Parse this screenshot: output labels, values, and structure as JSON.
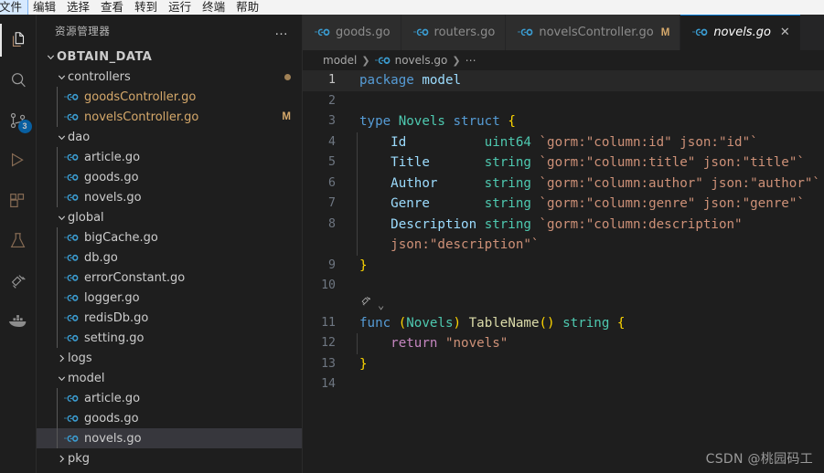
{
  "menubar": {
    "items": [
      {
        "label": "文件",
        "active": true
      },
      {
        "label": "编辑",
        "active": false
      },
      {
        "label": "选择",
        "active": false
      },
      {
        "label": "查看",
        "active": false
      },
      {
        "label": "转到",
        "active": false
      },
      {
        "label": "运行",
        "active": false
      },
      {
        "label": "终端",
        "active": false
      },
      {
        "label": "帮助",
        "active": false
      }
    ]
  },
  "activitybar": {
    "items": [
      {
        "name": "explorer",
        "icon": "files-icon",
        "selected": true,
        "badge": ""
      },
      {
        "name": "search",
        "icon": "search-icon",
        "selected": false,
        "badge": ""
      },
      {
        "name": "source-control",
        "icon": "source-control-icon",
        "selected": false,
        "badge": "3"
      },
      {
        "name": "run-debug",
        "icon": "run-and-debug-icon",
        "selected": false,
        "badge": ""
      },
      {
        "name": "extensions",
        "icon": "extensions-icon",
        "selected": false,
        "badge": ""
      },
      {
        "name": "testing",
        "icon": "beaker-icon",
        "selected": false,
        "badge": ""
      },
      {
        "name": "go",
        "icon": "go-gopher-icon",
        "selected": false,
        "badge": ""
      },
      {
        "name": "docker",
        "icon": "docker-whale-icon",
        "selected": false,
        "badge": ""
      }
    ]
  },
  "sidebar": {
    "title": "资源管理器",
    "more_actions": "…",
    "root": "OBTAIN_DATA",
    "tree": [
      {
        "label": "controllers",
        "type": "folder",
        "expanded": true,
        "depth": 1,
        "status": "dot"
      },
      {
        "label": "goodsController.go",
        "type": "go",
        "depth": 2,
        "modified": true,
        "status": ""
      },
      {
        "label": "novelsController.go",
        "type": "go",
        "depth": 2,
        "modified": true,
        "status": "M"
      },
      {
        "label": "dao",
        "type": "folder",
        "expanded": true,
        "depth": 1,
        "status": ""
      },
      {
        "label": "article.go",
        "type": "go",
        "depth": 2,
        "modified": false,
        "status": ""
      },
      {
        "label": "goods.go",
        "type": "go",
        "depth": 2,
        "modified": false,
        "status": ""
      },
      {
        "label": "novels.go",
        "type": "go",
        "depth": 2,
        "modified": false,
        "status": ""
      },
      {
        "label": "global",
        "type": "folder",
        "expanded": true,
        "depth": 1,
        "status": ""
      },
      {
        "label": "bigCache.go",
        "type": "go",
        "depth": 2,
        "modified": false,
        "status": ""
      },
      {
        "label": "db.go",
        "type": "go",
        "depth": 2,
        "modified": false,
        "status": ""
      },
      {
        "label": "errorConstant.go",
        "type": "go",
        "depth": 2,
        "modified": false,
        "status": ""
      },
      {
        "label": "logger.go",
        "type": "go",
        "depth": 2,
        "modified": false,
        "status": ""
      },
      {
        "label": "redisDb.go",
        "type": "go",
        "depth": 2,
        "modified": false,
        "status": ""
      },
      {
        "label": "setting.go",
        "type": "go",
        "depth": 2,
        "modified": false,
        "status": ""
      },
      {
        "label": "logs",
        "type": "folder",
        "expanded": false,
        "depth": 1,
        "status": ""
      },
      {
        "label": "model",
        "type": "folder",
        "expanded": true,
        "depth": 1,
        "status": ""
      },
      {
        "label": "article.go",
        "type": "go",
        "depth": 2,
        "modified": false,
        "status": ""
      },
      {
        "label": "goods.go",
        "type": "go",
        "depth": 2,
        "modified": false,
        "status": ""
      },
      {
        "label": "novels.go",
        "type": "go",
        "depth": 2,
        "modified": false,
        "status": "",
        "selected": true
      },
      {
        "label": "pkg",
        "type": "folder",
        "expanded": false,
        "depth": 1,
        "status": ""
      }
    ]
  },
  "editor": {
    "tabs": [
      {
        "label": "goods.go",
        "icon": "go-file-icon",
        "active": false,
        "dirty": "",
        "close": ""
      },
      {
        "label": "routers.go",
        "icon": "go-file-icon",
        "active": false,
        "dirty": "",
        "close": ""
      },
      {
        "label": "novelsController.go",
        "icon": "go-file-icon",
        "active": false,
        "dirty": "M",
        "close": ""
      },
      {
        "label": "novels.go",
        "icon": "go-file-icon",
        "active": true,
        "dirty": "",
        "close": "✕"
      }
    ],
    "breadcrumbs": [
      {
        "label": "model",
        "icon": ""
      },
      {
        "label": "novels.go",
        "icon": "go-file-icon"
      },
      {
        "label": "⋯",
        "icon": ""
      }
    ],
    "codelens": {
      "icon": "go-gopher-icon",
      "chevron": "⌄"
    },
    "lines": [
      {
        "num": "1",
        "current": true,
        "tokens": [
          {
            "t": "package",
            "c": "kw"
          },
          {
            "t": " ",
            "c": "pl"
          },
          {
            "t": "model",
            "c": "var"
          }
        ]
      },
      {
        "num": "2",
        "current": false,
        "tokens": []
      },
      {
        "num": "3",
        "current": false,
        "tokens": [
          {
            "t": "type",
            "c": "kw"
          },
          {
            "t": " ",
            "c": "pl"
          },
          {
            "t": "Novels",
            "c": "typ"
          },
          {
            "t": " ",
            "c": "pl"
          },
          {
            "t": "struct",
            "c": "kw"
          },
          {
            "t": " ",
            "c": "pl"
          },
          {
            "t": "{",
            "c": "br"
          }
        ]
      },
      {
        "num": "4",
        "current": false,
        "guide": true,
        "tokens": [
          {
            "t": "    ",
            "c": "pl"
          },
          {
            "t": "Id",
            "c": "var"
          },
          {
            "t": "          ",
            "c": "pl"
          },
          {
            "t": "uint64",
            "c": "typ"
          },
          {
            "t": " ",
            "c": "pl"
          },
          {
            "t": "`gorm:\"column:id\" json:\"id\"`",
            "c": "str"
          }
        ]
      },
      {
        "num": "5",
        "current": false,
        "guide": true,
        "tokens": [
          {
            "t": "    ",
            "c": "pl"
          },
          {
            "t": "Title",
            "c": "var"
          },
          {
            "t": "       ",
            "c": "pl"
          },
          {
            "t": "string",
            "c": "typ"
          },
          {
            "t": " ",
            "c": "pl"
          },
          {
            "t": "`gorm:\"column:title\" json:\"title\"`",
            "c": "str"
          }
        ]
      },
      {
        "num": "6",
        "current": false,
        "guide": true,
        "tokens": [
          {
            "t": "    ",
            "c": "pl"
          },
          {
            "t": "Author",
            "c": "var"
          },
          {
            "t": "      ",
            "c": "pl"
          },
          {
            "t": "string",
            "c": "typ"
          },
          {
            "t": " ",
            "c": "pl"
          },
          {
            "t": "`gorm:\"column:author\" json:\"author\"`",
            "c": "str"
          }
        ]
      },
      {
        "num": "7",
        "current": false,
        "guide": true,
        "tokens": [
          {
            "t": "    ",
            "c": "pl"
          },
          {
            "t": "Genre",
            "c": "var"
          },
          {
            "t": "       ",
            "c": "pl"
          },
          {
            "t": "string",
            "c": "typ"
          },
          {
            "t": " ",
            "c": "pl"
          },
          {
            "t": "`gorm:\"column:genre\" json:\"genre\"`",
            "c": "str"
          }
        ]
      },
      {
        "num": "8",
        "current": false,
        "guide": true,
        "tokens": [
          {
            "t": "    ",
            "c": "pl"
          },
          {
            "t": "Description",
            "c": "var"
          },
          {
            "t": " ",
            "c": "pl"
          },
          {
            "t": "string",
            "c": "typ"
          },
          {
            "t": " ",
            "c": "pl"
          },
          {
            "t": "`gorm:\"column:description\"",
            "c": "str"
          }
        ]
      },
      {
        "num": "",
        "current": false,
        "guide": true,
        "wrapped": true,
        "tokens": [
          {
            "t": "    ",
            "c": "pl"
          },
          {
            "t": "json:\"description\"`",
            "c": "str"
          }
        ]
      },
      {
        "num": "9",
        "current": false,
        "tokens": [
          {
            "t": "}",
            "c": "br"
          }
        ]
      },
      {
        "num": "10",
        "current": false,
        "tokens": []
      },
      {
        "num": "11",
        "current": false,
        "tokens": [
          {
            "t": "func",
            "c": "kw"
          },
          {
            "t": " ",
            "c": "pl"
          },
          {
            "t": "(",
            "c": "br"
          },
          {
            "t": "Novels",
            "c": "typ"
          },
          {
            "t": ")",
            "c": "br"
          },
          {
            "t": " ",
            "c": "pl"
          },
          {
            "t": "TableName",
            "c": "fn"
          },
          {
            "t": "(",
            "c": "br"
          },
          {
            "t": ")",
            "c": "br"
          },
          {
            "t": " ",
            "c": "pl"
          },
          {
            "t": "string",
            "c": "typ"
          },
          {
            "t": " ",
            "c": "pl"
          },
          {
            "t": "{",
            "c": "br"
          }
        ]
      },
      {
        "num": "12",
        "current": false,
        "guide": true,
        "tokens": [
          {
            "t": "    ",
            "c": "pl"
          },
          {
            "t": "return",
            "c": "kw2"
          },
          {
            "t": " ",
            "c": "pl"
          },
          {
            "t": "\"novels\"",
            "c": "str"
          }
        ]
      },
      {
        "num": "13",
        "current": false,
        "tokens": [
          {
            "t": "}",
            "c": "br"
          }
        ]
      },
      {
        "num": "14",
        "current": false,
        "tokens": []
      }
    ]
  },
  "watermark": "CSDN @桃园码工",
  "colors": {
    "editor_bg": "#1e1e1e",
    "tab_inactive_bg": "#2d2d2d",
    "tab_active_border": "#0078d4",
    "selection_bg": "#37373d",
    "modified_fg": "#d6a96b",
    "badge_bg": "#0078d4"
  }
}
